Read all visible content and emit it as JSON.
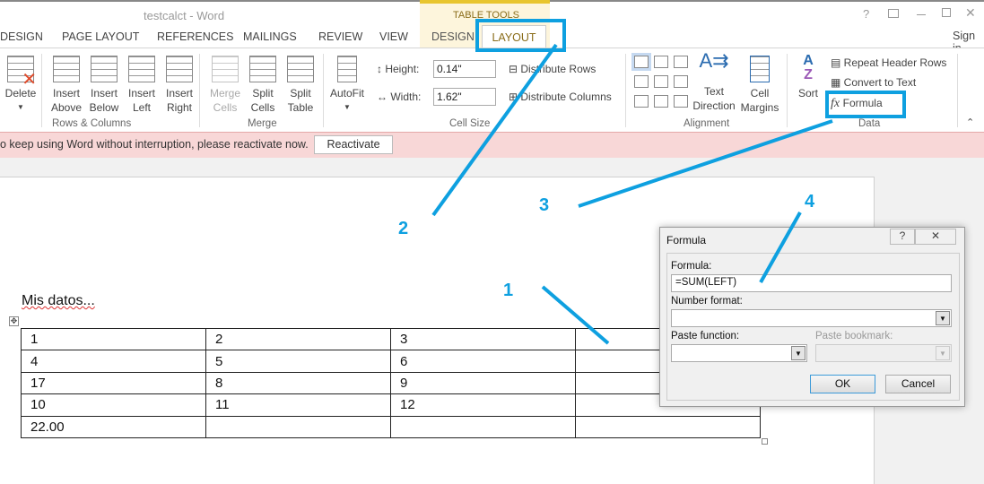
{
  "window": {
    "title": "testcalct - Word",
    "controls": [
      "?",
      "restore-ribbon",
      "minimize",
      "maximize",
      "close"
    ],
    "sign_in": "Sign in"
  },
  "tabs": {
    "contextual_group": "TABLE TOOLS",
    "items": [
      "DESIGN",
      "PAGE LAYOUT",
      "REFERENCES",
      "MAILINGS",
      "REVIEW",
      "VIEW",
      "DESIGN"
    ],
    "selected": "LAYOUT"
  },
  "ribbon": {
    "rows_columns": {
      "label": "Rows & Columns",
      "delete": "Delete",
      "insert_above": [
        "Insert",
        "Above"
      ],
      "insert_below": [
        "Insert",
        "Below"
      ],
      "insert_left": [
        "Insert",
        "Left"
      ],
      "insert_right": [
        "Insert",
        "Right"
      ]
    },
    "merge": {
      "label": "Merge",
      "merge_cells": [
        "Merge",
        "Cells"
      ],
      "split_cells": [
        "Split",
        "Cells"
      ],
      "split_table": [
        "Split",
        "Table"
      ]
    },
    "cell_size": {
      "label": "Cell Size",
      "autofit": "AutoFit",
      "height_label": "Height:",
      "height_value": "0.14\"",
      "width_label": "Width:",
      "width_value": "1.62\"",
      "distribute_rows": "Distribute Rows",
      "distribute_columns": "Distribute Columns"
    },
    "alignment": {
      "label": "Alignment",
      "text_direction": [
        "Text",
        "Direction"
      ],
      "cell_margins": [
        "Cell",
        "Margins"
      ]
    },
    "data": {
      "label": "Data",
      "sort": "Sort",
      "repeat_header_rows": "Repeat Header Rows",
      "convert_to_text": "Convert to Text",
      "formula": "Formula"
    }
  },
  "notice": {
    "text": "o keep using Word without interruption, please reactivate now.",
    "button": "Reactivate"
  },
  "document": {
    "heading": "Mis datos...",
    "table": [
      [
        "1",
        "2",
        "3",
        ""
      ],
      [
        "4",
        "5",
        "6",
        ""
      ],
      [
        "17",
        "8",
        "9",
        ""
      ],
      [
        "10",
        "11",
        "12",
        ""
      ],
      [
        " 22.00",
        "",
        "",
        ""
      ]
    ]
  },
  "dialog": {
    "title": "Formula",
    "formula_label": "Formula:",
    "formula_value": "=SUM(LEFT)",
    "number_format_label": "Number format:",
    "number_format_value": "",
    "paste_function_label": "Paste function:",
    "paste_bookmark_label": "Paste bookmark:",
    "ok": "OK",
    "cancel": "Cancel"
  },
  "annotations": {
    "color": "#0ea0e0",
    "labels": [
      "1",
      "2",
      "3",
      "4"
    ]
  }
}
